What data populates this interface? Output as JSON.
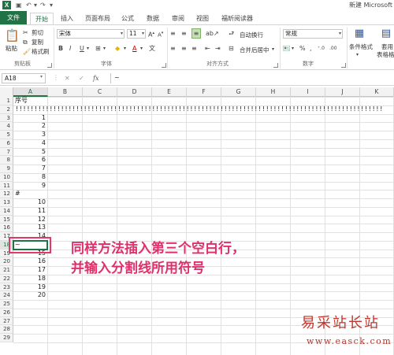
{
  "titlebar": {
    "app_icon_letter": "X",
    "window_title": "新建 Microsoft"
  },
  "tabs": [
    {
      "label": "文件"
    },
    {
      "label": "开始"
    },
    {
      "label": "插入"
    },
    {
      "label": "页面布局"
    },
    {
      "label": "公式"
    },
    {
      "label": "数据"
    },
    {
      "label": "审阅"
    },
    {
      "label": "视图"
    },
    {
      "label": "福昕阅读器"
    }
  ],
  "ribbon": {
    "clipboard": {
      "paste": "粘贴",
      "cut": "剪切",
      "copy": "复制",
      "format_painter": "格式刷",
      "group": "剪贴板"
    },
    "font": {
      "font_name": "宋体",
      "font_size": "11",
      "bold": "B",
      "italic": "I",
      "underline": "U",
      "group": "字体"
    },
    "align": {
      "wrap": "自动换行",
      "merge": "合并后居中",
      "group": "对齐方式"
    },
    "number": {
      "format": "常规",
      "group": "数字"
    },
    "styles": {
      "conditional": "条件格式",
      "table1": "套用",
      "table2": "表格格式"
    }
  },
  "formula_bar": {
    "name_box": "A18",
    "cancel": "✕",
    "confirm": "✓",
    "fx": "fx",
    "content": "~"
  },
  "sheet": {
    "columns": [
      "A",
      "B",
      "C",
      "D",
      "E",
      "F",
      "G",
      "H",
      "I",
      "J",
      "K"
    ],
    "rows": [
      "1",
      "2",
      "3",
      "4",
      "5",
      "6",
      "7",
      "8",
      "9",
      "10",
      "11",
      "12",
      "13",
      "14",
      "15",
      "16",
      "17",
      "18",
      "19",
      "20",
      "21",
      "22",
      "23",
      "24",
      "25",
      "26",
      "27",
      "28",
      "29"
    ],
    "a1": "序号",
    "row2_fill": "!!!!!!!!!!!!!!!!!!!!!!!!!!!!!!!!!!!!!!!!!!!!!!!!!!!!!!!!!!!!!!!!!!!!!!!!!!!!!!!!!!!!!!!!!!!!!!!!!",
    "a12": "#",
    "a18": "~",
    "values": [
      "1",
      "2",
      "3",
      "4",
      "5",
      "6",
      "7",
      "8",
      "9",
      "",
      "10",
      "11",
      "12",
      "13",
      "14",
      "",
      "15",
      "16",
      "17",
      "18",
      "19",
      "20"
    ]
  },
  "annotation": {
    "line1": "同样方法插入第三个空白行，",
    "line2": "并输入分割线所用符号"
  },
  "watermark": {
    "name": "易采站长站",
    "url": "www.easck.com"
  }
}
